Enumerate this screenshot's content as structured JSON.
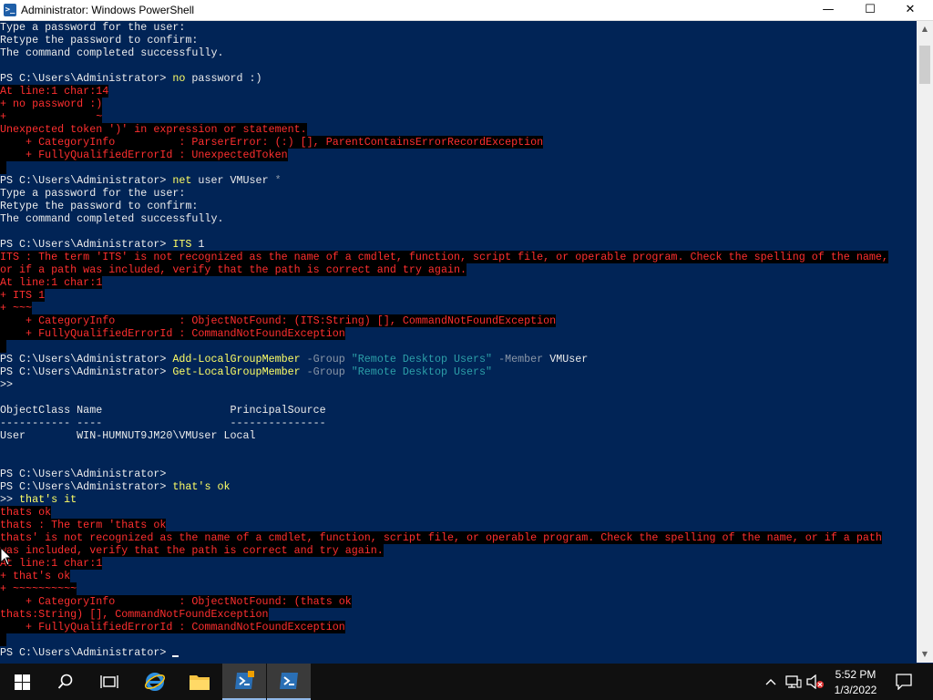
{
  "window": {
    "title": "Administrator: Windows PowerShell",
    "icon": "powershell-icon",
    "controls": {
      "minimize": "—",
      "maximize": "☐",
      "close": "✕"
    }
  },
  "console": {
    "lines": [
      [
        {
          "t": "Type a password for the user:",
          "c": "out"
        }
      ],
      [
        {
          "t": "Retype the password to confirm:",
          "c": "out"
        }
      ],
      [
        {
          "t": "The command completed successfully.",
          "c": "out"
        }
      ],
      [],
      [
        {
          "t": "PS C:\\Users\\Administrator> ",
          "c": "out"
        },
        {
          "t": "no",
          "c": "cmd"
        },
        {
          "t": " password :)",
          "c": "arg"
        }
      ],
      [
        {
          "t": "At line:1 char:14",
          "c": "err"
        }
      ],
      [
        {
          "t": "+ no password :)",
          "c": "err"
        }
      ],
      [
        {
          "t": "+              ~",
          "c": "err"
        }
      ],
      [
        {
          "t": "Unexpected token ')' in expression or statement.",
          "c": "err"
        }
      ],
      [
        {
          "t": "    + CategoryInfo          : ParserError: (:) [], ParentContainsErrorRecordException",
          "c": "err"
        }
      ],
      [
        {
          "t": "    + FullyQualifiedErrorId : UnexpectedToken",
          "c": "err"
        }
      ],
      [
        {
          "t": " ",
          "c": "err"
        }
      ],
      [
        {
          "t": "PS C:\\Users\\Administrator> ",
          "c": "out"
        },
        {
          "t": "net",
          "c": "cmd"
        },
        {
          "t": " user VMUser ",
          "c": "arg"
        },
        {
          "t": "*",
          "c": "par"
        }
      ],
      [
        {
          "t": "Type a password for the user:",
          "c": "out"
        }
      ],
      [
        {
          "t": "Retype the password to confirm:",
          "c": "out"
        }
      ],
      [
        {
          "t": "The command completed successfully.",
          "c": "out"
        }
      ],
      [],
      [
        {
          "t": "PS C:\\Users\\Administrator> ",
          "c": "out"
        },
        {
          "t": "ITS",
          "c": "cmd"
        },
        {
          "t": " 1",
          "c": "arg"
        }
      ],
      [
        {
          "t": "ITS : The term 'ITS' is not recognized as the name of a cmdlet, function, script file, or operable program. Check the spelling of the name,",
          "c": "err"
        }
      ],
      [
        {
          "t": "or if a path was included, verify that the path is correct and try again.",
          "c": "err"
        }
      ],
      [
        {
          "t": "At line:1 char:1",
          "c": "err"
        }
      ],
      [
        {
          "t": "+ ITS 1",
          "c": "err"
        }
      ],
      [
        {
          "t": "+ ~~~",
          "c": "err"
        }
      ],
      [
        {
          "t": "    + CategoryInfo          : ObjectNotFound: (ITS:String) [], CommandNotFoundException",
          "c": "err"
        }
      ],
      [
        {
          "t": "    + FullyQualifiedErrorId : CommandNotFoundException",
          "c": "err"
        }
      ],
      [
        {
          "t": " ",
          "c": "err"
        }
      ],
      [
        {
          "t": "PS C:\\Users\\Administrator> ",
          "c": "out"
        },
        {
          "t": "Add-LocalGroupMember",
          "c": "cmd"
        },
        {
          "t": " -Group ",
          "c": "par"
        },
        {
          "t": "\"Remote Desktop Users\"",
          "c": "str"
        },
        {
          "t": " -Member ",
          "c": "par"
        },
        {
          "t": "VMUser",
          "c": "arg"
        }
      ],
      [
        {
          "t": "PS C:\\Users\\Administrator> ",
          "c": "out"
        },
        {
          "t": "Get-LocalGroupMember",
          "c": "cmd"
        },
        {
          "t": " -Group ",
          "c": "par"
        },
        {
          "t": "\"Remote Desktop Users\"",
          "c": "str"
        }
      ],
      [
        {
          "t": ">>",
          "c": "out"
        }
      ],
      [],
      [
        {
          "t": "ObjectClass Name                    PrincipalSource",
          "c": "out"
        }
      ],
      [
        {
          "t": "----------- ----                    ---------------",
          "c": "out"
        }
      ],
      [
        {
          "t": "User        WIN-HUMNUT9JM20\\VMUser Local",
          "c": "out"
        }
      ],
      [],
      [],
      [
        {
          "t": "PS C:\\Users\\Administrator>",
          "c": "out"
        }
      ],
      [
        {
          "t": "PS C:\\Users\\Administrator> ",
          "c": "out"
        },
        {
          "t": "that's ok",
          "c": "cmd"
        }
      ],
      [
        {
          "t": ">> ",
          "c": "out"
        },
        {
          "t": "that's it",
          "c": "cmd"
        }
      ],
      [
        {
          "t": "thats ok",
          "c": "err"
        }
      ],
      [
        {
          "t": "thats : The term 'thats ok",
          "c": "err"
        }
      ],
      [
        {
          "t": "thats' is not recognized as the name of a cmdlet, function, script file, or operable program. Check the spelling of the name, or if a path",
          "c": "err"
        }
      ],
      [
        {
          "t": "was included, verify that the path is correct and try again.",
          "c": "err"
        }
      ],
      [
        {
          "t": "At line:1 char:1",
          "c": "err"
        }
      ],
      [
        {
          "t": "+ that's ok",
          "c": "err"
        }
      ],
      [
        {
          "t": "+ ~~~~~~~~~~",
          "c": "err"
        }
      ],
      [
        {
          "t": "    + CategoryInfo          : ObjectNotFound: (thats ok",
          "c": "err"
        }
      ],
      [
        {
          "t": "thats:String) [], CommandNotFoundException",
          "c": "err"
        }
      ],
      [
        {
          "t": "    + FullyQualifiedErrorId : CommandNotFoundException",
          "c": "err"
        }
      ],
      [
        {
          "t": " ",
          "c": "err"
        }
      ],
      [
        {
          "t": "PS C:\\Users\\Administrator> ",
          "c": "out"
        },
        {
          "t": "",
          "c": "cursor"
        }
      ]
    ]
  },
  "colors": {
    "console_bg": "#012456",
    "output": "#ececec",
    "error_fg": "#ff2f2f",
    "error_bg": "#000000",
    "command": "#ffff66",
    "parameter": "#8b97a8",
    "string": "#2c9fa8",
    "taskbar": "#101010"
  },
  "taskbar": {
    "items": [
      {
        "name": "start-button",
        "icon": "windows-logo-icon"
      },
      {
        "name": "search-button",
        "icon": "search-icon"
      },
      {
        "name": "task-view-button",
        "icon": "task-view-icon"
      },
      {
        "name": "internet-explorer-button",
        "icon": "internet-explorer-icon"
      },
      {
        "name": "file-explorer-button",
        "icon": "folder-icon"
      },
      {
        "name": "server-manager-button",
        "icon": "server-manager-icon"
      },
      {
        "name": "powershell-button",
        "icon": "powershell-icon"
      }
    ],
    "tray": {
      "icons": [
        "chevron-up-icon",
        "network-icon",
        "volume-muted-icon"
      ],
      "time": "5:52 PM",
      "date": "1/3/2022",
      "notifications_icon": "notification-icon"
    }
  }
}
